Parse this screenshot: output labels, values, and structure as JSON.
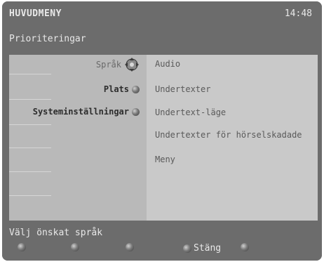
{
  "header": {
    "title": "HUVUDMENY",
    "time": "14:48",
    "breadcrumb": "Prioriteringar"
  },
  "menu": {
    "items": [
      {
        "label": "Språk",
        "icon": "dpad-icon"
      },
      {
        "label": "Plats",
        "icon": "round-button-icon"
      },
      {
        "label": "Systeminställningar",
        "icon": "round-button-icon"
      }
    ]
  },
  "submenu": {
    "items": [
      "Audio",
      "Undertexter",
      "Undertext-läge",
      "Undertexter för hörselskadade",
      "Meny"
    ]
  },
  "footer": {
    "hint": "Välj önskat språk",
    "keys": [
      {
        "label": "",
        "icon": "red-key-icon"
      },
      {
        "label": "",
        "icon": "green-key-icon"
      },
      {
        "label": "",
        "icon": "yellow-key-icon"
      },
      {
        "label": "Stäng",
        "icon": "blue-key-icon"
      },
      {
        "label": "",
        "icon": "white-key-icon"
      }
    ]
  }
}
